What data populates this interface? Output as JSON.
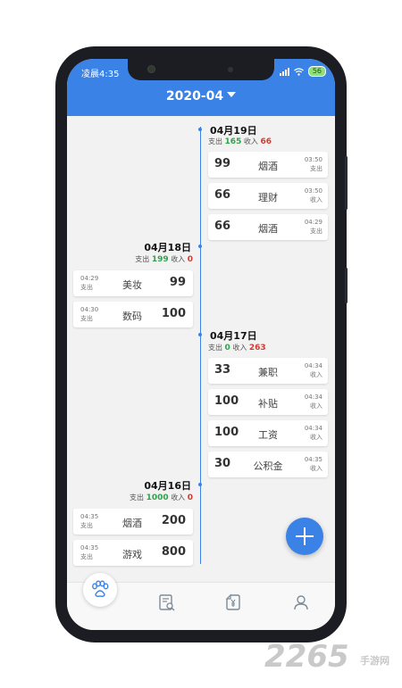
{
  "status_bar": {
    "time": "凌晨4:35",
    "battery": "56"
  },
  "header": {
    "month": "2020-04"
  },
  "days": [
    {
      "date": "04月19日",
      "out_label": "支出",
      "out": "165",
      "in_label": "收入",
      "in": "66",
      "entries": [
        {
          "amount": "99",
          "category": "烟酒",
          "time": "03:50",
          "type": "支出"
        },
        {
          "amount": "66",
          "category": "理财",
          "time": "03:50",
          "type": "收入"
        },
        {
          "amount": "66",
          "category": "烟酒",
          "time": "04:29",
          "type": "支出"
        }
      ]
    },
    {
      "date": "04月18日",
      "out_label": "支出",
      "out": "199",
      "in_label": "收入",
      "in": "0",
      "entries": [
        {
          "amount": "99",
          "category": "美妆",
          "time": "04:29",
          "type": "支出"
        },
        {
          "amount": "100",
          "category": "数码",
          "time": "04:30",
          "type": "支出"
        }
      ]
    },
    {
      "date": "04月17日",
      "out_label": "支出",
      "out": "0",
      "in_label": "收入",
      "in": "263",
      "entries": [
        {
          "amount": "33",
          "category": "兼职",
          "time": "04:34",
          "type": "收入"
        },
        {
          "amount": "100",
          "category": "补贴",
          "time": "04:34",
          "type": "收入"
        },
        {
          "amount": "100",
          "category": "工资",
          "time": "04:34",
          "type": "收入"
        },
        {
          "amount": "30",
          "category": "公积金",
          "time": "04:35",
          "type": "收入"
        }
      ]
    },
    {
      "date": "04月16日",
      "out_label": "支出",
      "out": "1000",
      "in_label": "收入",
      "in": "0",
      "entries": [
        {
          "amount": "200",
          "category": "烟酒",
          "time": "04:35",
          "type": "支出"
        },
        {
          "amount": "800",
          "category": "游戏",
          "time": "04:35",
          "type": "支出"
        }
      ]
    }
  ],
  "tabbar": {
    "icons": [
      "paw-icon",
      "bill-search-icon",
      "yuan-transfer-icon",
      "user-icon"
    ]
  },
  "watermark": {
    "brand": "2265",
    "sub": "手游网"
  },
  "colors": {
    "primary": "#3b82e6",
    "expense": "#2fa34a",
    "income": "#d03a30"
  }
}
